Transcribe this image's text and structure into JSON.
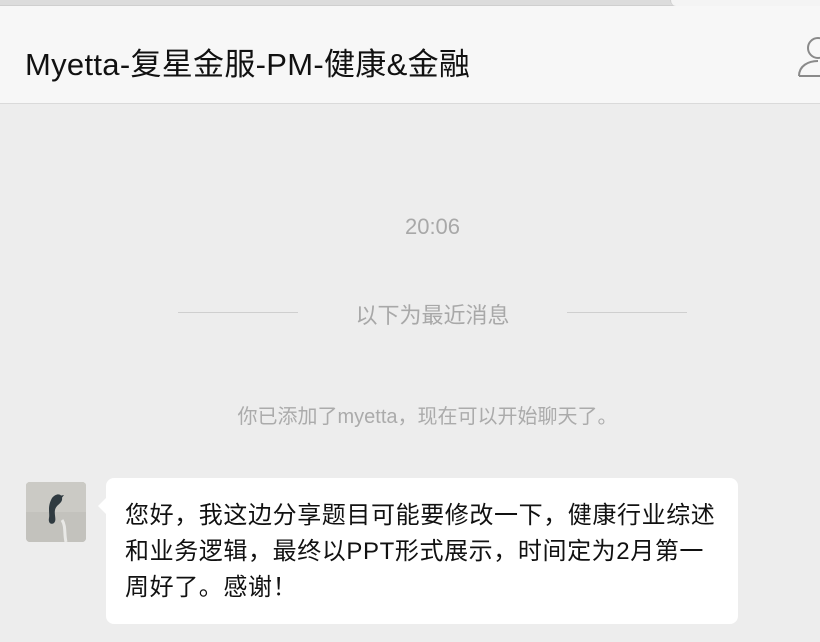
{
  "chat": {
    "title": "Myetta-复星金服-PM-健康&金融"
  },
  "messages": {
    "timestamp": "20:06",
    "divider_text": "以下为最近消息",
    "system_notice": "你已添加了myetta，现在可以开始聊天了。",
    "incoming": {
      "text": "您好，我这边分享题目可能要修改一下，健康行业综述和业务逻辑，最终以PPT形式展示，时间定为2月第一周好了。感谢！"
    }
  },
  "icons": {
    "profile": "person-icon"
  }
}
